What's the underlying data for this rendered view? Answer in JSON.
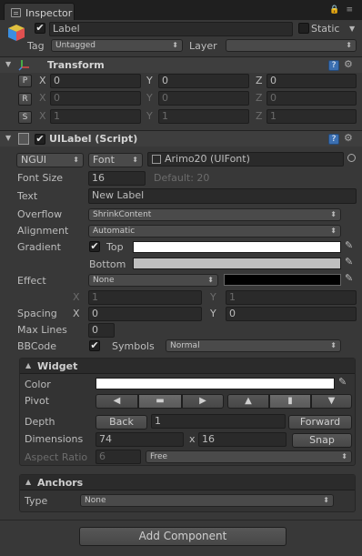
{
  "tab": {
    "title": "Inspector"
  },
  "object": {
    "name": "Label",
    "static_label": "Static",
    "tag_label": "Tag",
    "tag_value": "Untagged",
    "layer_label": "Layer",
    "layer_value": ""
  },
  "transform": {
    "title": "Transform",
    "position": {
      "btn": "P",
      "x": "0",
      "y": "0",
      "z": "0"
    },
    "rotation": {
      "btn": "R",
      "x": "0",
      "y": "0",
      "z": "0"
    },
    "scale": {
      "btn": "S",
      "x": "1",
      "y": "1",
      "z": "1"
    },
    "axis": {
      "x": "X",
      "y": "Y",
      "z": "Z"
    }
  },
  "uilabel": {
    "title": "UILabel (Script)",
    "font_type": "NGUI",
    "font_kind": "Font",
    "font_value": "Arimo20 (UIFont)",
    "font_size_label": "Font Size",
    "font_size": "16",
    "font_size_default": "Default: 20",
    "text_label": "Text",
    "text_value": "New Label",
    "overflow_label": "Overflow",
    "overflow_value": "ShrinkContent",
    "alignment_label": "Alignment",
    "alignment_value": "Automatic",
    "gradient_label": "Gradient",
    "gradient_top": "Top",
    "gradient_bottom": "Bottom",
    "effect_label": "Effect",
    "effect_value": "None",
    "effect_x": "1",
    "effect_y": "1",
    "spacing_label": "Spacing",
    "spacing_x": "0",
    "spacing_y": "0",
    "max_lines_label": "Max Lines",
    "max_lines": "0",
    "bbcode_label": "BBCode",
    "symbols_label": "Symbols",
    "symbols_value": "Normal",
    "axis_x": "X",
    "axis_y": "Y"
  },
  "widget": {
    "title": "Widget",
    "color_label": "Color",
    "pivot_label": "Pivot",
    "depth_label": "Depth",
    "back_label": "Back",
    "depth_value": "1",
    "forward_label": "Forward",
    "dimensions_label": "Dimensions",
    "width": "74",
    "x_sep": "x",
    "height": "16",
    "snap_label": "Snap",
    "aspect_label": "Aspect Ratio",
    "aspect_value": "6",
    "aspect_mode": "Free"
  },
  "anchors": {
    "title": "Anchors",
    "type_label": "Type",
    "type_value": "None"
  },
  "add_component_label": "Add Component",
  "colors": {
    "bg": "#383838",
    "accent": "#3b6fb1",
    "white": "#ffffff"
  }
}
